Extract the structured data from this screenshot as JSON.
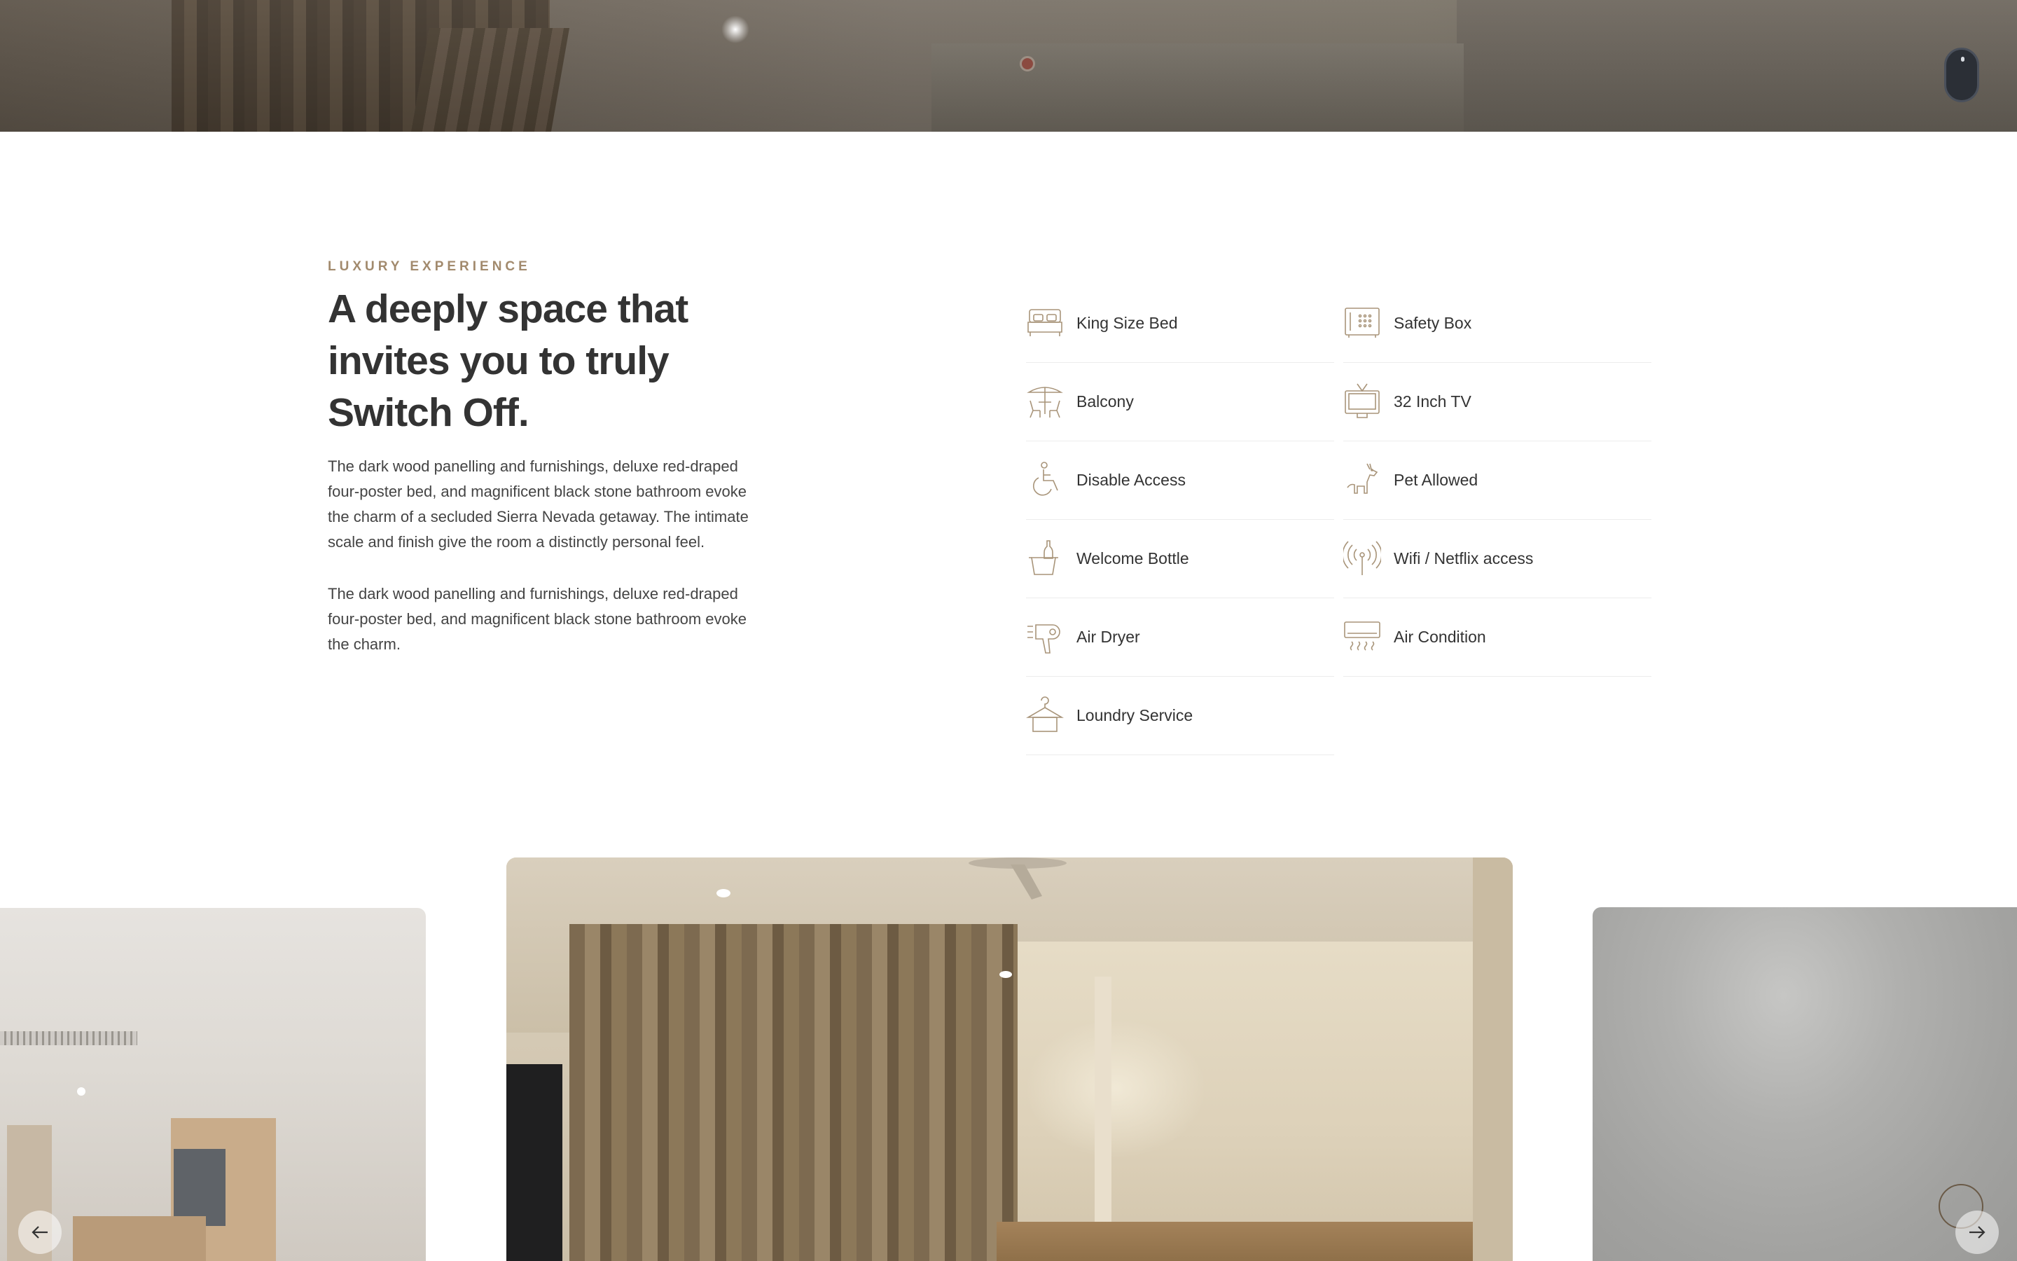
{
  "section": {
    "eyebrow": "LUXURY EXPERIENCE",
    "heading": "A deeply space that invites you to truly Switch Off.",
    "paragraphs": [
      "The dark wood panelling and furnishings, deluxe red-draped four-poster bed, and magnificent black stone bathroom evoke the charm of a secluded Sierra Nevada getaway. The intimate scale and finish give the room a distinctly personal feel.",
      "The dark wood panelling and furnishings, deluxe red-draped four-poster bed, and magnificent black stone bathroom evoke the charm."
    ]
  },
  "amenities": [
    {
      "label": "King Size Bed",
      "icon": "bed-icon"
    },
    {
      "label": "Safety Box",
      "icon": "safe-icon"
    },
    {
      "label": "Balcony",
      "icon": "balcony-icon"
    },
    {
      "label": "32 Inch TV",
      "icon": "tv-icon"
    },
    {
      "label": "Disable Access",
      "icon": "wheelchair-icon"
    },
    {
      "label": "Pet Allowed",
      "icon": "dog-icon"
    },
    {
      "label": "Welcome Bottle",
      "icon": "champagne-icon"
    },
    {
      "label": "Wifi / Netflix access",
      "icon": "wifi-antenna-icon"
    },
    {
      "label": "Air Dryer",
      "icon": "hair-dryer-icon"
    },
    {
      "label": "Air Condition",
      "icon": "air-conditioner-icon"
    },
    {
      "label": "Loundry Service",
      "icon": "hanger-icon"
    }
  ],
  "theme": {
    "accent": "#a28a6d",
    "heading_color": "#333333",
    "icon_color": "#a89479"
  },
  "gallery": {
    "prev_icon": "arrow-left-icon",
    "next_icon": "arrow-right-icon"
  }
}
